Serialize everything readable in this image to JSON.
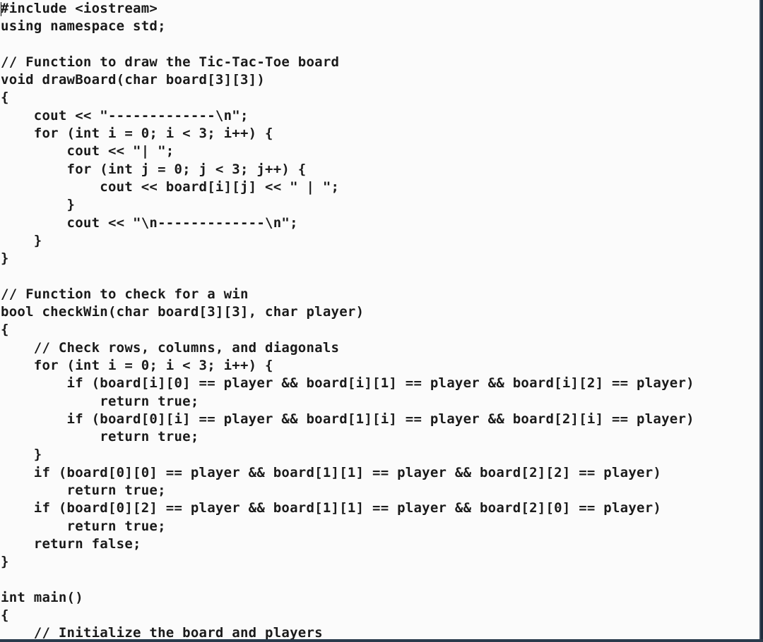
{
  "editor": {
    "lines": [
      "#include <iostream>",
      "using namespace std;",
      "",
      "// Function to draw the Tic-Tac-Toe board",
      "void drawBoard(char board[3][3])",
      "{",
      "    cout << \"-------------\\n\";",
      "    for (int i = 0; i < 3; i++) {",
      "        cout << \"| \";",
      "        for (int j = 0; j < 3; j++) {",
      "            cout << board[i][j] << \" | \";",
      "        }",
      "        cout << \"\\n-------------\\n\";",
      "    }",
      "}",
      "",
      "// Function to check for a win",
      "bool checkWin(char board[3][3], char player)",
      "{",
      "    // Check rows, columns, and diagonals",
      "    for (int i = 0; i < 3; i++) {",
      "        if (board[i][0] == player && board[i][1] == player && board[i][2] == player)",
      "            return true;",
      "        if (board[0][i] == player && board[1][i] == player && board[2][i] == player)",
      "            return true;",
      "    }",
      "    if (board[0][0] == player && board[1][1] == player && board[2][2] == player)",
      "        return true;",
      "    if (board[0][2] == player && board[1][1] == player && board[2][0] == player)",
      "        return true;",
      "    return false;",
      "}",
      "",
      "int main()",
      "{",
      "    // Initialize the board and players"
    ]
  }
}
